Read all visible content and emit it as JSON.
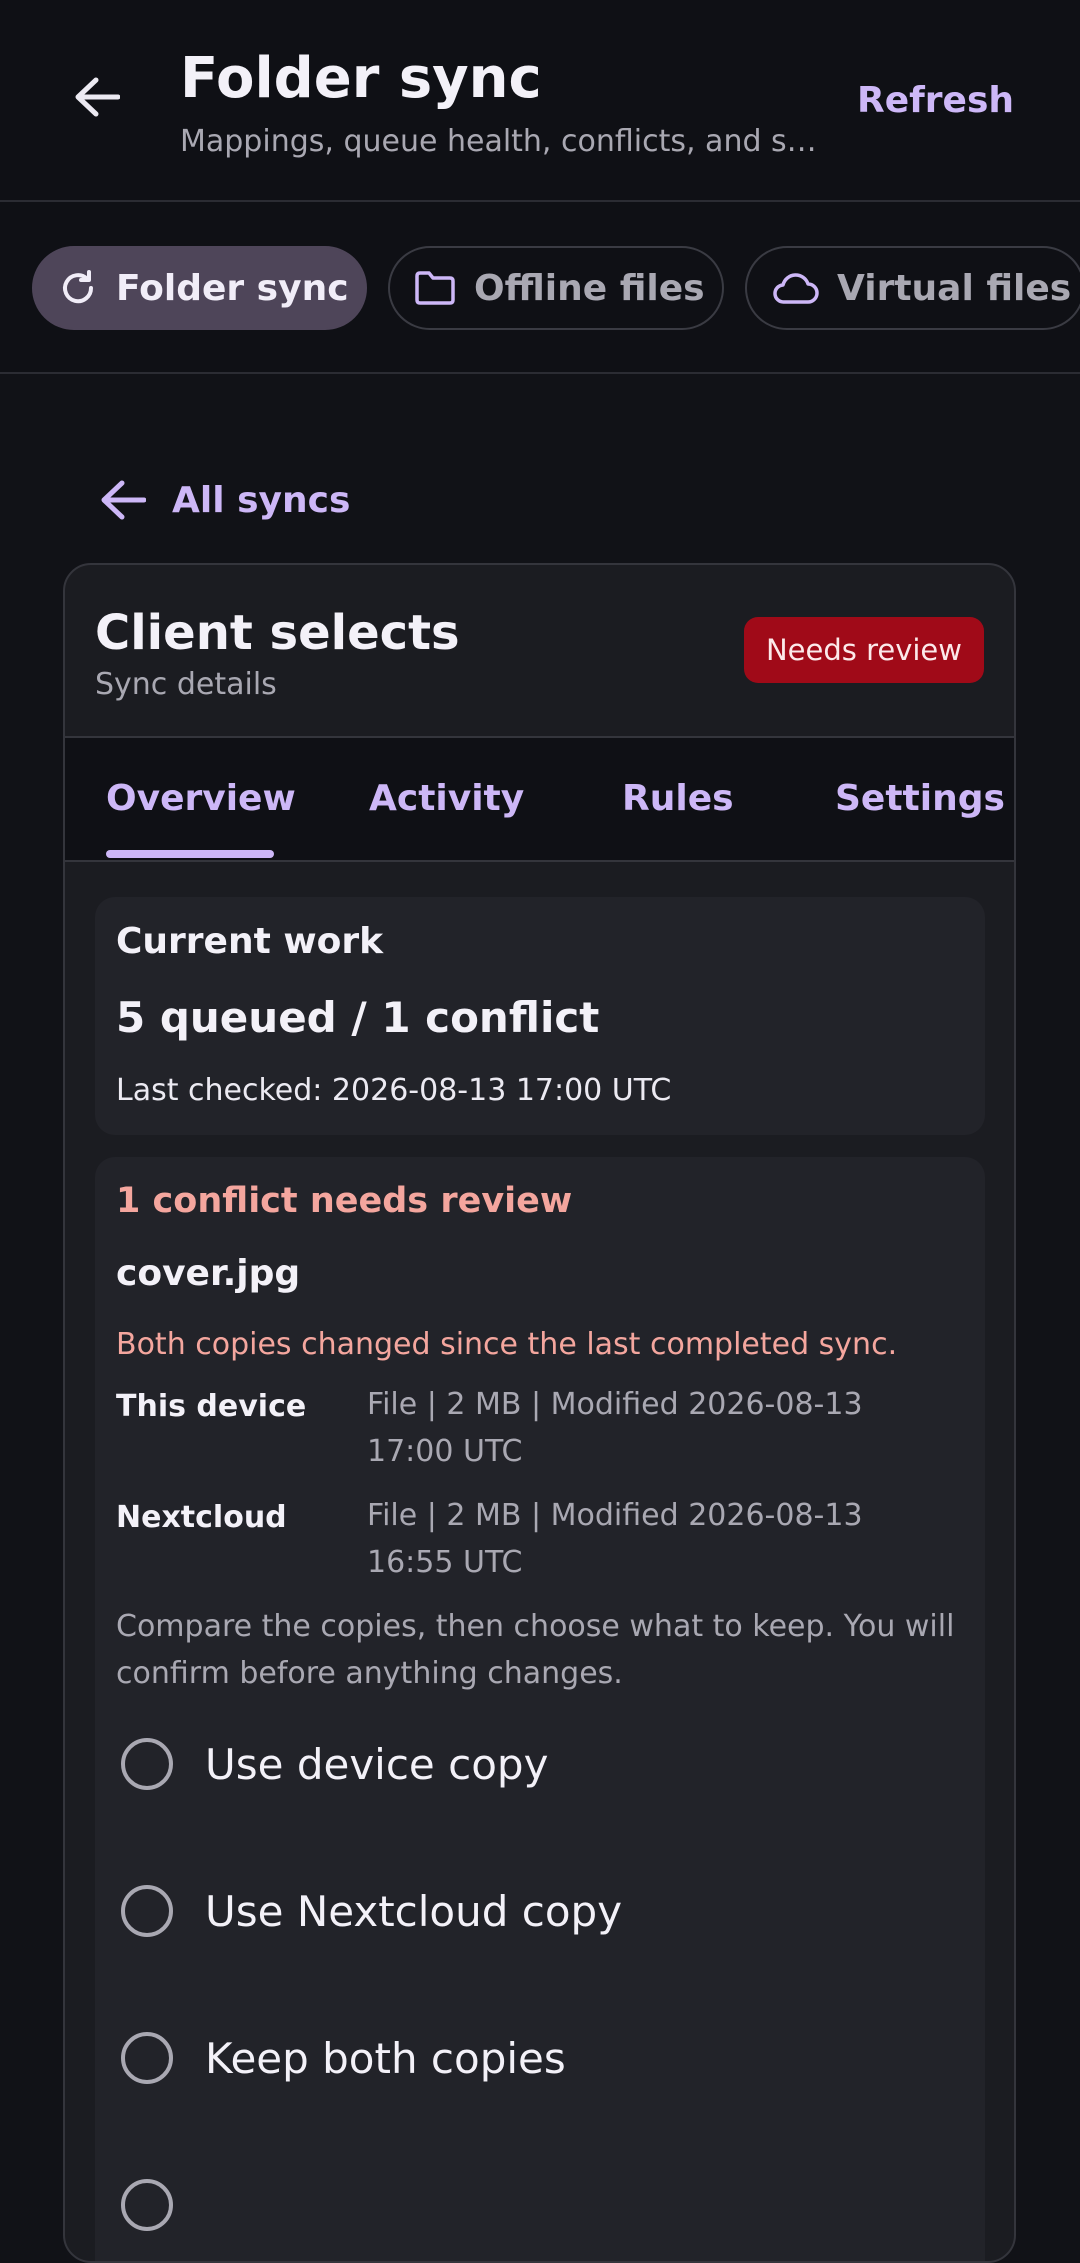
{
  "appbar": {
    "title": "Folder sync",
    "subtitle": "Mappings, queue health, conflicts, and sy...",
    "refresh_label": "Refresh"
  },
  "chips": [
    {
      "label": "Folder sync",
      "icon": "refresh-icon",
      "active": true
    },
    {
      "label": "Offline files",
      "icon": "folder-icon",
      "active": false
    },
    {
      "label": "Virtual files",
      "icon": "cloud-icon",
      "active": false
    }
  ],
  "back_link": {
    "label": "All syncs"
  },
  "card": {
    "title": "Client selects",
    "subtitle": "Sync details",
    "badge": "Needs review",
    "badge_color": "#A00A18"
  },
  "tabs": [
    {
      "label": "Overview",
      "selected": true
    },
    {
      "label": "Activity",
      "selected": false
    },
    {
      "label": "Rules",
      "selected": false
    },
    {
      "label": "Settings",
      "selected": false
    }
  ],
  "current_work": {
    "heading": "Current work",
    "summary": "5 queued / 1 conflict",
    "last_checked": "Last checked: 2026-08-13 17:00 UTC"
  },
  "conflict": {
    "heading": "1 conflict needs review",
    "file_name": "cover.jpg",
    "reason": "Both copies changed since the last completed sync.",
    "copies": [
      {
        "source": "This device",
        "details": "File | 2 MB | Modified 2026-08-13 17:00 UTC"
      },
      {
        "source": "Nextcloud",
        "details": "File | 2 MB | Modified 2026-08-13 16:55 UTC"
      }
    ],
    "help": "Compare the copies, then choose what to keep. You will confirm before anything changes.",
    "options": [
      "Use device copy",
      "Use Nextcloud copy",
      "Keep both copies"
    ]
  },
  "colors": {
    "accent": "#CDB7F7",
    "alert": "#F4A69E",
    "background": "#111217"
  }
}
